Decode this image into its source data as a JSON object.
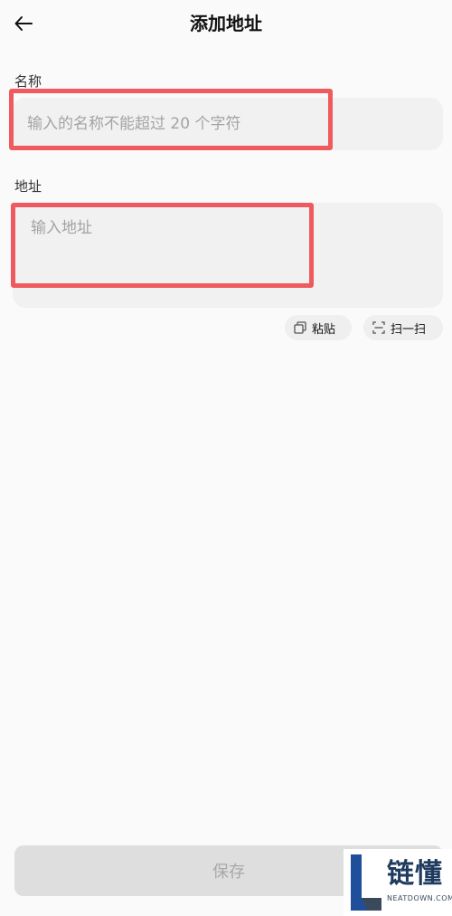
{
  "header": {
    "title": "添加地址"
  },
  "form": {
    "name_label": "名称",
    "name_placeholder": "输入的名称不能超过 20 个字符",
    "address_label": "地址",
    "address_placeholder": "输入地址"
  },
  "actions": {
    "paste_label": "粘贴",
    "scan_label": "扫一扫",
    "save_label": "保存"
  },
  "watermark": {
    "brand": "链懂",
    "domain": "NEATDOWN.COM"
  },
  "colors": {
    "highlight": "#ee5a5d",
    "input_bg": "#f1f1f1",
    "save_disabled_bg": "#dedede",
    "save_disabled_text": "#a8a8a8"
  },
  "icons": {
    "back": "arrow-left-icon",
    "paste": "copy-icon",
    "scan": "scan-frame-icon"
  }
}
